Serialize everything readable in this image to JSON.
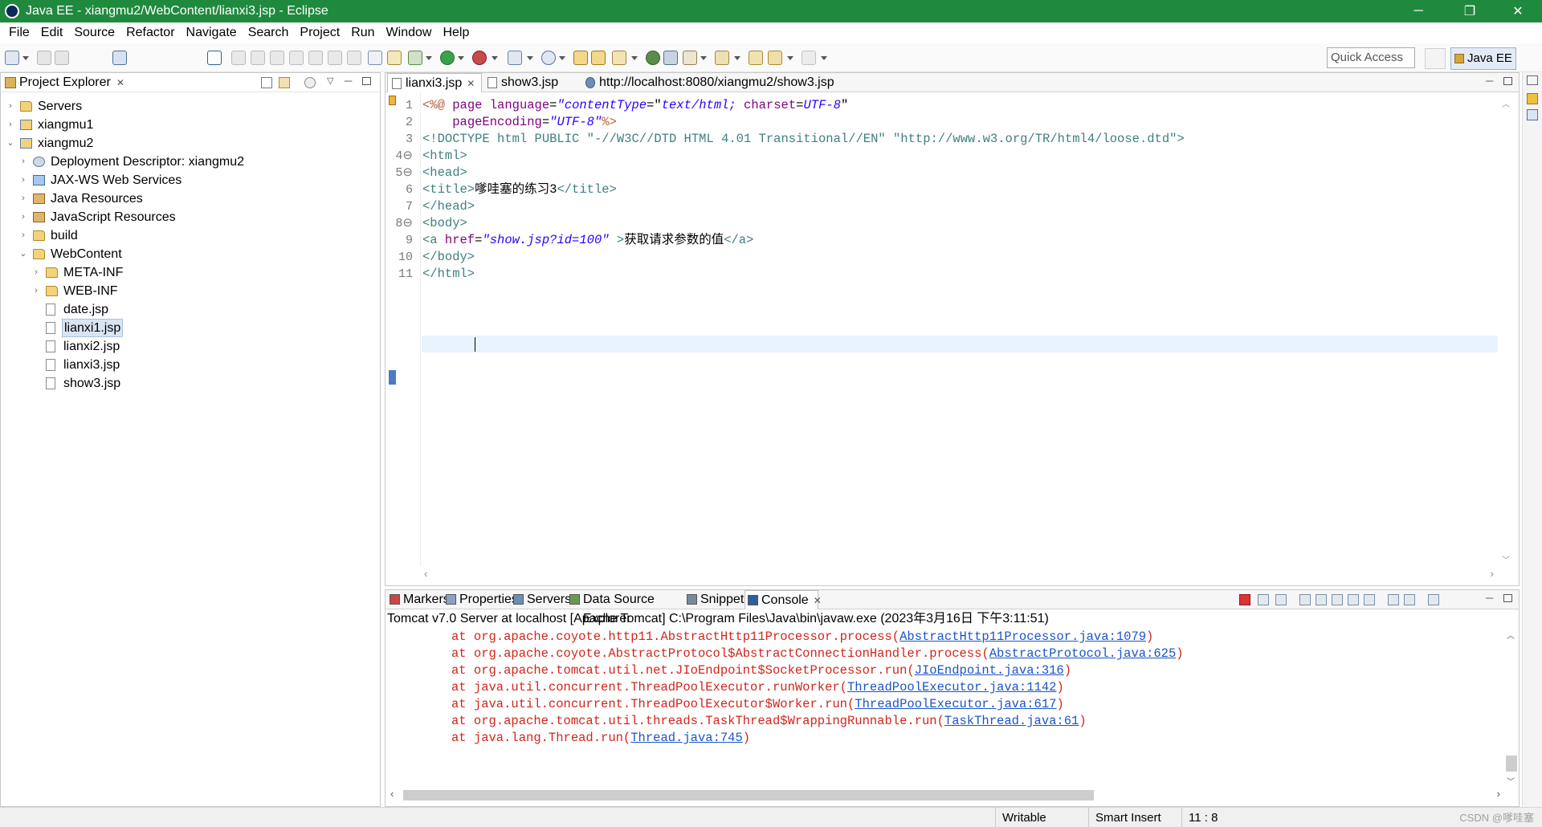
{
  "window": {
    "title": "Java EE - xiangmu2/WebContent/lianxi3.jsp - Eclipse",
    "controls": {
      "minimize": "─",
      "maximize": "❐",
      "close": "✕"
    }
  },
  "menu": [
    "File",
    "Edit",
    "Source",
    "Refactor",
    "Navigate",
    "Search",
    "Project",
    "Run",
    "Window",
    "Help"
  ],
  "toolbar": {
    "quick_access": "Quick Access",
    "perspective": "Java EE"
  },
  "project_explorer": {
    "title": "Project Explorer",
    "close": "✕",
    "tree": [
      {
        "label": "Servers",
        "twisty": "›",
        "icon": "folder"
      },
      {
        "label": "xiangmu1",
        "twisty": "›",
        "icon": "project"
      },
      {
        "label": "xiangmu2",
        "twisty": "⌄",
        "icon": "project"
      },
      {
        "label": "Deployment Descriptor: xiangmu2",
        "twisty": "›",
        "icon": "gear"
      },
      {
        "label": "JAX-WS Web Services",
        "twisty": "›",
        "icon": "web"
      },
      {
        "label": "Java Resources",
        "twisty": "›",
        "icon": "jar"
      },
      {
        "label": "JavaScript Resources",
        "twisty": "›",
        "icon": "jar"
      },
      {
        "label": "build",
        "twisty": "›",
        "icon": "folder"
      },
      {
        "label": "WebContent",
        "twisty": "⌄",
        "icon": "folder"
      },
      {
        "label": "META-INF",
        "twisty": "›",
        "icon": "folder"
      },
      {
        "label": "WEB-INF",
        "twisty": "›",
        "icon": "folder"
      },
      {
        "label": "date.jsp",
        "twisty": "",
        "icon": "file"
      },
      {
        "label": "lianxi1.jsp",
        "twisty": "",
        "icon": "file",
        "selected": true
      },
      {
        "label": "lianxi2.jsp",
        "twisty": "",
        "icon": "file"
      },
      {
        "label": "lianxi3.jsp",
        "twisty": "",
        "icon": "file"
      },
      {
        "label": "show3.jsp",
        "twisty": "",
        "icon": "file"
      }
    ]
  },
  "editor": {
    "tabs": [
      {
        "label": "lianxi3.jsp",
        "close": "✕",
        "active": true
      },
      {
        "label": "show3.jsp",
        "close": ""
      },
      {
        "label": "http://localhost:8080/xiangmu2/show3.jsp",
        "close": ""
      }
    ],
    "line_numbers": [
      "1",
      "2",
      "3",
      "4⊖",
      "5⊖",
      "6",
      "7",
      "8⊖",
      "9",
      "10",
      "11"
    ],
    "lines": [
      [
        [
          "c-dir",
          "<%@ "
        ],
        [
          "c-attr",
          "page "
        ],
        [
          "c-attr",
          "language"
        ],
        [
          "c-txt",
          "="
        ],
        [
          "c-str",
          "\"contentType"
        ],
        [
          "c-txt",
          "=\""
        ],
        [
          "c-str",
          "text/html; "
        ],
        [
          "c-attr",
          "charset"
        ],
        [
          "c-txt",
          "="
        ],
        [
          "c-str",
          "UTF-8"
        ],
        [
          "c-txt",
          "\""
        ]
      ],
      [
        [
          "c-txt",
          "    "
        ],
        [
          "c-attr",
          "pageEncoding"
        ],
        [
          "c-txt",
          "="
        ],
        [
          "c-str",
          "\"UTF-8\""
        ],
        [
          "c-dir",
          "%>"
        ]
      ],
      [
        [
          "c-doc",
          "<!DOCTYPE html PUBLIC "
        ],
        [
          "c-docs",
          "\"-//W3C//DTD HTML 4.01 Transitional//EN\" \"http://www.w3.org/TR/html4/loose.dtd\""
        ],
        [
          "c-doc",
          ">"
        ]
      ],
      [
        [
          "c-tag",
          "<html>"
        ]
      ],
      [
        [
          "c-tag",
          "<head>"
        ]
      ],
      [
        [
          "c-tag",
          "<title>"
        ],
        [
          "c-txt",
          "嗲哇塞的练习3"
        ],
        [
          "c-tag",
          "</title>"
        ]
      ],
      [
        [
          "c-tag",
          "</head>"
        ]
      ],
      [
        [
          "c-tag",
          "<body>"
        ]
      ],
      [
        [
          "c-tag",
          "<a "
        ],
        [
          "c-attr",
          "href"
        ],
        [
          "c-txt",
          "="
        ],
        [
          "c-str",
          "\"show.jsp?id=100\""
        ],
        [
          "c-tag",
          " >"
        ],
        [
          "c-txt",
          "获取请求参数的值"
        ],
        [
          "c-tag",
          "</a>"
        ]
      ],
      [
        [
          "c-tag",
          "</body>"
        ]
      ],
      [
        [
          "c-tag",
          "</html>"
        ]
      ]
    ],
    "cursor": "11 : 8"
  },
  "bottom_panel": {
    "tabs": [
      {
        "label": "Markers",
        "icon": "markers-icon"
      },
      {
        "label": "Properties",
        "icon": "properties-icon"
      },
      {
        "label": "Servers",
        "icon": "servers-icon"
      },
      {
        "label": "Data Source Explorer",
        "icon": "datasource-icon"
      },
      {
        "label": "Snippets",
        "icon": "snippets-icon"
      },
      {
        "label": "Console",
        "icon": "console-icon",
        "active": true,
        "close": "✕"
      }
    ],
    "console_description": "Tomcat v7.0 Server at localhost [Apache Tomcat] C:\\Program Files\\Java\\bin\\javaw.exe (2023年3月16日 下午3:11:51)",
    "stack_trace": [
      {
        "text": "at org.apache.coyote.http11.AbstractHttp11Processor.process(",
        "link": "AbstractHttp11Processor.java:1079",
        "end": ")"
      },
      {
        "text": "at org.apache.coyote.AbstractProtocol$AbstractConnectionHandler.process(",
        "link": "AbstractProtocol.java:625",
        "end": ")"
      },
      {
        "text": "at org.apache.tomcat.util.net.JIoEndpoint$SocketProcessor.run(",
        "link": "JIoEndpoint.java:316",
        "end": ")"
      },
      {
        "text": "at java.util.concurrent.ThreadPoolExecutor.runWorker(",
        "link": "ThreadPoolExecutor.java:1142",
        "end": ")"
      },
      {
        "text": "at java.util.concurrent.ThreadPoolExecutor$Worker.run(",
        "link": "ThreadPoolExecutor.java:617",
        "end": ")"
      },
      {
        "text": "at org.apache.tomcat.util.threads.TaskThread$WrappingRunnable.run(",
        "link": "TaskThread.java:61",
        "end": ")"
      },
      {
        "text": "at java.lang.Thread.run(",
        "link": "Thread.java:745",
        "end": ")"
      }
    ]
  },
  "status": {
    "writable": "Writable",
    "insert_mode": "Smart Insert",
    "position": "11 : 8",
    "watermark": "CSDN @嗲哇塞"
  },
  "colors": {
    "titlebar": "#1f8a3d",
    "selection": "#d9e4f1",
    "current_line": "#e8f2fe",
    "stack_trace": "#d0261c",
    "link": "#1a55c7"
  }
}
